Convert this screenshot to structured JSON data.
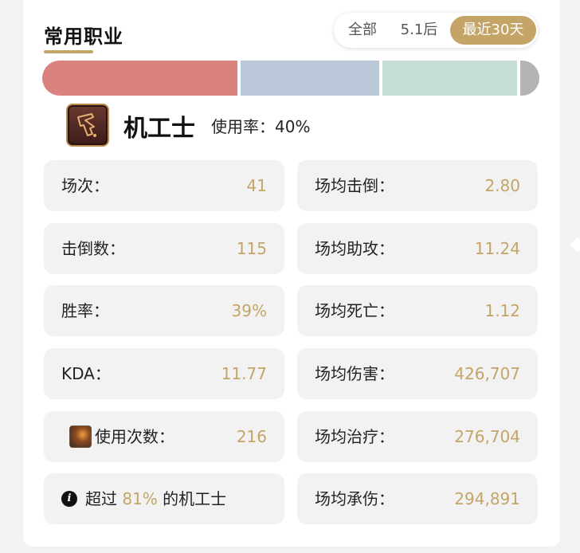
{
  "section": {
    "title": "常用职业"
  },
  "time_filter": {
    "tabs": [
      {
        "label": "全部"
      },
      {
        "label": "5.1后"
      },
      {
        "label": "最近30天",
        "active": true
      }
    ]
  },
  "usage_bar": {
    "segments": [
      {
        "share": 0.4,
        "color": "#da827e"
      },
      {
        "share": 0.285,
        "color": "#bbc8d9"
      },
      {
        "share": 0.275,
        "color": "#c7ddd7"
      },
      {
        "share": 0.04,
        "color": "#b3b3b3"
      }
    ]
  },
  "job": {
    "icon": "machinist-job-icon",
    "name": "机工士",
    "usage_label": "使用率：",
    "usage_value": "40%"
  },
  "stats_left": [
    {
      "label": "场次：",
      "value": "41"
    },
    {
      "label": "击倒数：",
      "value": "115"
    },
    {
      "label": "胜率：",
      "value": "39%"
    },
    {
      "label": "KDA：",
      "value": "11.77"
    },
    {
      "label": "使用次数：",
      "value": "216",
      "icon": "skill-icon"
    }
  ],
  "stats_right": [
    {
      "label": "场均击倒：",
      "value": "2.80"
    },
    {
      "label": "场均助攻：",
      "value": "11.24"
    },
    {
      "label": "场均死亡：",
      "value": "1.12"
    },
    {
      "label": "场均伤害：",
      "value": "426,707"
    },
    {
      "label": "场均治疗：",
      "value": "276,704"
    },
    {
      "label": "场均承伤：",
      "value": "294,891"
    }
  ],
  "exceed": {
    "icon_text": "i",
    "prefix": "超过 ",
    "percent": "81%",
    "suffix": " 的机工士"
  },
  "colors": {
    "accent": "#c4a467",
    "tile_bg": "#f2f2f2"
  }
}
